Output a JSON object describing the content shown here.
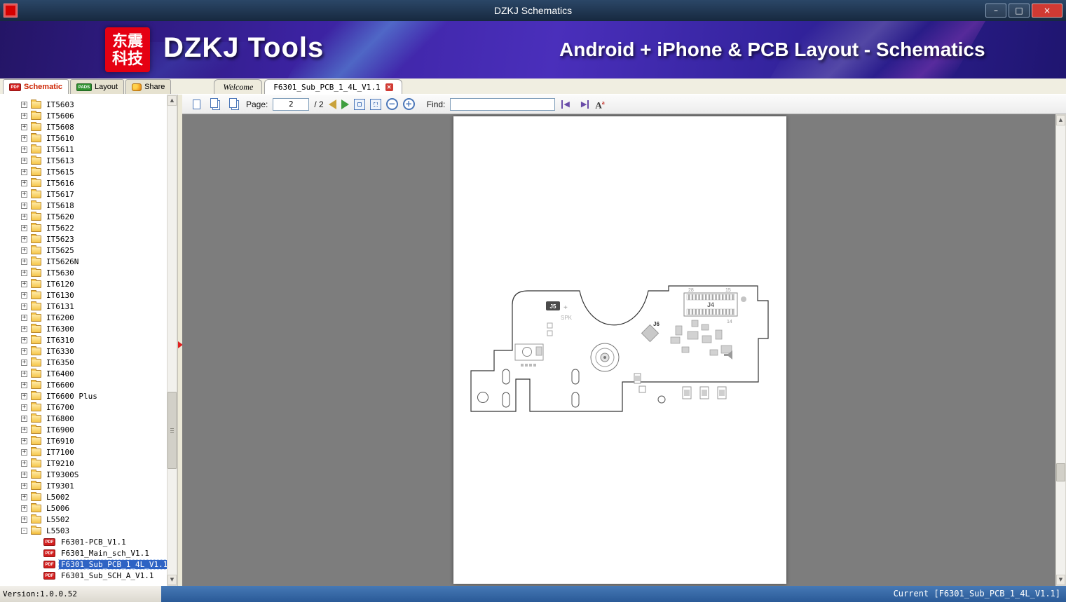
{
  "window": {
    "title": "DZKJ Schematics",
    "minimize_glyph": "–",
    "maximize_glyph": "□",
    "close_glyph": "×"
  },
  "banner": {
    "logo_line1": "东震",
    "logo_line2": "科技",
    "app_name": "DZKJ Tools",
    "tagline": "Android + iPhone & PCB Layout - Schematics"
  },
  "icons": {
    "pdf_badge": "PDF",
    "pads_badge": "PADS",
    "expand_collapsed": "+",
    "expand_expanded": "-",
    "close_small": "✕",
    "zoom_out": "−",
    "zoom_in": "+",
    "scroll_up": "▲",
    "scroll_down": "▼",
    "find_prev": "◀",
    "find_next": "▶",
    "font_icon_main": "A",
    "font_icon_sup": "a"
  },
  "tabs": {
    "schematic": "Schematic",
    "layout": "Layout",
    "share": "Share"
  },
  "doc_tabs": [
    {
      "label": "Welcome",
      "active": false,
      "closable": false
    },
    {
      "label": "F6301_Sub_PCB_1_4L_V1.1",
      "active": true,
      "closable": true
    }
  ],
  "tree": {
    "folders": [
      "IT5603",
      "IT5606",
      "IT5608",
      "IT5610",
      "IT5611",
      "IT5613",
      "IT5615",
      "IT5616",
      "IT5617",
      "IT5618",
      "IT5620",
      "IT5622",
      "IT5623",
      "IT5625",
      "IT5626N",
      "IT5630",
      "IT6120",
      "IT6130",
      "IT6131",
      "IT6200",
      "IT6300",
      "IT6310",
      "IT6330",
      "IT6350",
      "IT6400",
      "IT6600",
      "IT6600 Plus",
      "IT6700",
      "IT6800",
      "IT6900",
      "IT6910",
      "IT7100",
      "IT9210",
      "IT9300S",
      "IT9301",
      "L5002",
      "L5006",
      "L5502",
      "L5503"
    ],
    "expanded_folder": "L5503",
    "files": [
      {
        "label": "F6301-PCB_V1.1",
        "selected": false
      },
      {
        "label": "F6301_Main_sch_V1.1",
        "selected": false
      },
      {
        "label": "F6301_Sub_PCB_1_4L_V1.1",
        "selected": true
      },
      {
        "label": "F6301_Sub_SCH_A_V1.1",
        "selected": false
      }
    ]
  },
  "toolbar": {
    "page_label": "Page:",
    "page_value": "2",
    "page_total": "/ 2",
    "find_label": "Find:",
    "find_value": ""
  },
  "pcb": {
    "labels": {
      "j4": "J4",
      "j5": "J5",
      "j6": "J6",
      "spk": "SPK",
      "pin28": "28",
      "pin15": "15",
      "pin14": "14",
      "plus": "+"
    }
  },
  "statusbar": {
    "version": "Version:1.0.0.52",
    "current": "Current [F6301_Sub_PCB_1_4L_V1.1]"
  }
}
